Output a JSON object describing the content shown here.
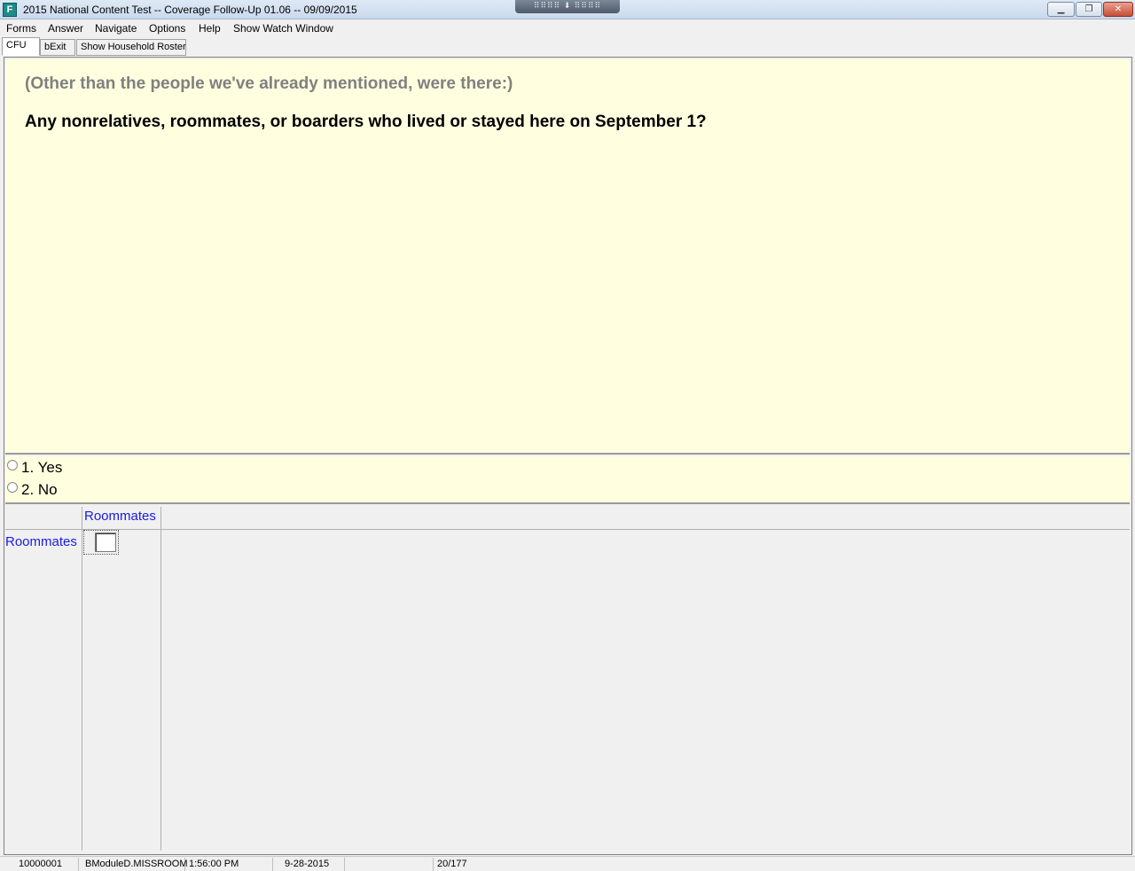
{
  "window": {
    "title": "2015 National Content Test -- Coverage Follow-Up 01.06 -- 09/09/2015",
    "icon_label": "F",
    "remote_bar": "⠿⠿⠿⠿ ⬇ ⠿⠿⠿⠿",
    "min_glyph": "▁",
    "max_glyph": "❐",
    "close_glyph": "✕"
  },
  "menu": [
    "Forms",
    "Answer",
    "Navigate",
    "Options",
    "Help",
    "Show Watch Window"
  ],
  "tabs": [
    {
      "label": "CFU",
      "active": true
    },
    {
      "label": "bExit",
      "active": false
    },
    {
      "label": "Show Household Roster",
      "active": false
    }
  ],
  "question": {
    "preamble": "(Other than the people we've already mentioned, were there:)",
    "text": "Any nonrelatives, roommates, or boarders who lived or stayed here on September 1?"
  },
  "answers": [
    {
      "label": "1. Yes",
      "selected": false
    },
    {
      "label": "2. No",
      "selected": false
    }
  ],
  "grid": {
    "column_header": "Roommates",
    "row_header": "Roommates",
    "cell_value": ""
  },
  "status": {
    "case_id": "10000001",
    "field": "BModuleD.MISSROOM",
    "time": "1:56:00 PM",
    "date": "9-28-2015",
    "blank": "",
    "position": "20/177"
  },
  "colors": {
    "question_bg": "#ffffe0",
    "link_blue": "#1a1ae6",
    "preamble_gray": "#808080"
  }
}
